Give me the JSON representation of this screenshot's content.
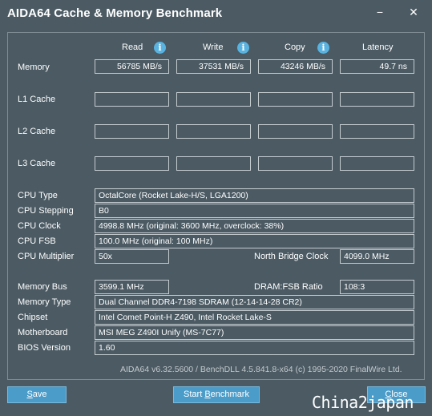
{
  "window": {
    "title": "AIDA64 Cache & Memory Benchmark",
    "minimize_glyph": "−",
    "close_glyph": "✕"
  },
  "headers": {
    "read": "Read",
    "write": "Write",
    "copy": "Copy",
    "latency": "Latency",
    "info_glyph": "i"
  },
  "rows": {
    "memory": {
      "label": "Memory",
      "read": "56785 MB/s",
      "write": "37531 MB/s",
      "copy": "43246 MB/s",
      "latency": "49.7 ns"
    },
    "l1": {
      "label": "L1 Cache",
      "read": "",
      "write": "",
      "copy": "",
      "latency": ""
    },
    "l2": {
      "label": "L2 Cache",
      "read": "",
      "write": "",
      "copy": "",
      "latency": ""
    },
    "l3": {
      "label": "L3 Cache",
      "read": "",
      "write": "",
      "copy": "",
      "latency": ""
    }
  },
  "cpu": {
    "type_label": "CPU Type",
    "type": "OctalCore  (Rocket Lake-H/S, LGA1200)",
    "stepping_label": "CPU Stepping",
    "stepping": "B0",
    "clock_label": "CPU Clock",
    "clock": "4998.8 MHz  (original: 3600 MHz, overclock: 38%)",
    "fsb_label": "CPU FSB",
    "fsb": "100.0 MHz  (original: 100 MHz)",
    "multiplier_label": "CPU Multiplier",
    "multiplier": "50x",
    "nb_clock_label": "North Bridge Clock",
    "nb_clock": "4099.0 MHz"
  },
  "memory_info": {
    "bus_label": "Memory Bus",
    "bus": "3599.1 MHz",
    "ratio_label": "DRAM:FSB Ratio",
    "ratio": "108:3",
    "type_label": "Memory Type",
    "type": "Dual Channel DDR4-7198 SDRAM  (12-14-14-28 CR2)",
    "chipset_label": "Chipset",
    "chipset": "Intel Comet Point-H Z490, Intel Rocket Lake-S",
    "motherboard_label": "Motherboard",
    "motherboard": "MSI MEG Z490I Unify (MS-7C77)",
    "bios_label": "BIOS Version",
    "bios": "1.60"
  },
  "footer": "AIDA64 v6.32.5600 / BenchDLL 4.5.841.8-x64  (c) 1995-2020 FinalWire Ltd.",
  "buttons": {
    "save_pre": "",
    "save_ul": "S",
    "save_post": "ave",
    "start_pre": "Start ",
    "start_ul": "B",
    "start_post": "enchmark",
    "close_pre": "",
    "close_ul": "C",
    "close_post": "lose"
  },
  "watermark": "China2japan"
}
